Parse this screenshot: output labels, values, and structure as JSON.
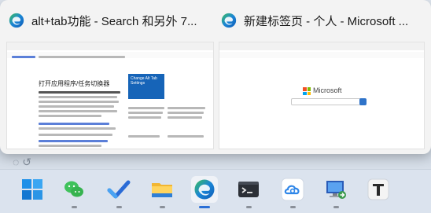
{
  "windows": [
    {
      "title": "alt+tab功能 - Search 和另外 7...",
      "icon": "edge-icon",
      "thumbnail": {
        "page_heading": "打开应用程序/任务切换器",
        "promo_text": "Change Alt Tab Settings"
      }
    },
    {
      "title": "新建标签页 - 个人 - Microsoft ...",
      "icon": "edge-icon",
      "thumbnail": {
        "logo_text": "Microsoft"
      }
    }
  ],
  "taskbar": {
    "items": [
      {
        "name": "start-button",
        "icon": "windows-start-icon"
      },
      {
        "name": "wechat",
        "icon": "wechat-icon"
      },
      {
        "name": "todo",
        "icon": "todo-checkmark-icon"
      },
      {
        "name": "file-explorer",
        "icon": "folder-icon"
      },
      {
        "name": "edge",
        "icon": "edge-icon"
      },
      {
        "name": "terminal",
        "icon": "terminal-icon"
      },
      {
        "name": "cloud-drive",
        "icon": "cloud-icon"
      },
      {
        "name": "remote-desktop",
        "icon": "remote-desktop-icon"
      },
      {
        "name": "typora",
        "icon": "typora-t-icon"
      }
    ]
  },
  "colors": {
    "accent": "#2b6fd6",
    "edge_blue": "#1b86d6",
    "edge_green": "#3bbf5a"
  }
}
